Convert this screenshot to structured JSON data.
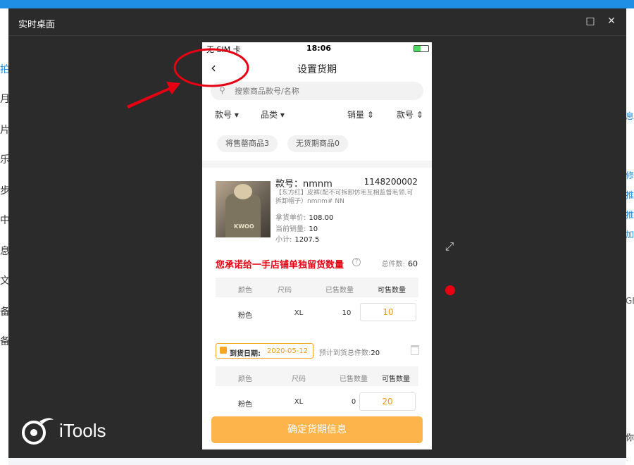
{
  "background_app": {
    "left_chars": [
      "拍",
      "月",
      "片",
      "乐",
      "步",
      "中",
      "息",
      "文",
      "备",
      "备"
    ],
    "right_chars": [
      "息",
      "修",
      "推",
      "推",
      "加",
      "GB",
      "你"
    ]
  },
  "window": {
    "title": "实时桌面",
    "maximize_icon": "□",
    "close_icon": "✕"
  },
  "phone": {
    "status": {
      "carrier": "无 SIM 卡",
      "time": "18:06",
      "battery_level": 0.45
    },
    "nav": {
      "back_icon": "‹",
      "title": "设置货期"
    },
    "search": {
      "placeholder": "搜索商品款号/名称"
    },
    "filters": [
      "款号 ▾",
      "品类 ▾",
      "销量 ⇕",
      "款号 ⇕"
    ],
    "chips": [
      "将售罄商品3",
      "无货期商品0"
    ],
    "product": {
      "title": "款号：nmnm",
      "code": "1148200002",
      "desc": "【东方红】皮裤(配不可拆卸仿毛互相监督毛领,可拆卸帽子）nmnm#  NN",
      "price_label": "拿货单价:",
      "price": "108.00",
      "sales_label": "当前销量:",
      "sales": "10",
      "subtotal_label": "小计:",
      "subtotal": "1207.5",
      "image_text": "KWOO"
    },
    "promise": {
      "text": "您承诺给一手店铺单独留货数量",
      "total_label": "总件数:",
      "total": "60"
    },
    "table_headers": [
      "颜色",
      "尺码",
      "已售数量",
      "可售数量"
    ],
    "row1": {
      "color": "粉色",
      "size": "XL",
      "sold": "10",
      "available": "10"
    },
    "delivery": {
      "label": "到货日期:",
      "date": "2020-05-12",
      "est_label": "预计到货总件数:",
      "est_value": "20"
    },
    "row2": {
      "color": "粉色",
      "size": "XL",
      "sold": "0",
      "available": "20"
    },
    "confirm_button": "确定货期信息"
  },
  "overlay": {
    "logo_text": "iTools",
    "expand_icon": "⤢"
  }
}
